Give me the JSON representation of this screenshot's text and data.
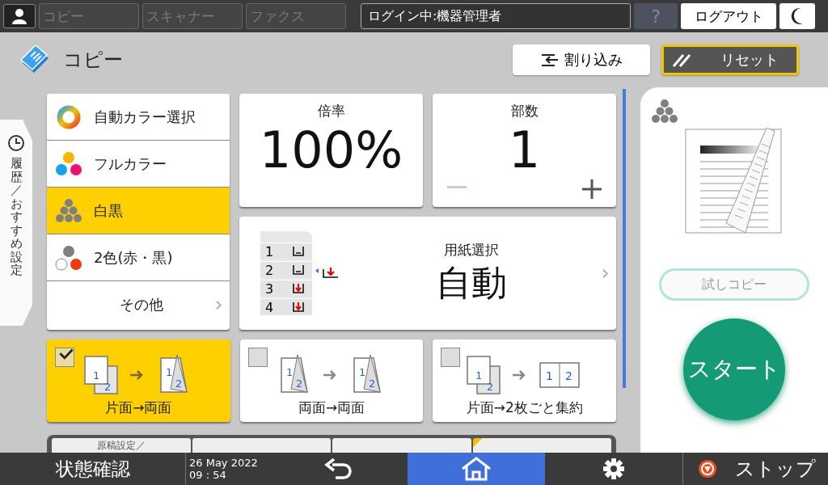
{
  "top_bar": {
    "tabs": [
      {
        "label": "コピー",
        "disabled": true
      },
      {
        "label": "スキャナー",
        "disabled": true
      },
      {
        "label": "ファクス",
        "disabled": true
      }
    ],
    "login": "ログイン中:機器管理者",
    "help": {
      "label": "?",
      "disabled": true
    },
    "logout": "ログアウト"
  },
  "header": {
    "title": "コピー",
    "interrupt": "割り込み",
    "reset": "リセット"
  },
  "side_tab": "履歴／おすすめ設定",
  "color_modes": [
    {
      "label": "自動カラー選択",
      "kind": "auto",
      "selected": false
    },
    {
      "label": "フルカラー",
      "kind": "full",
      "selected": false
    },
    {
      "label": "白黒",
      "kind": "bw",
      "selected": true
    },
    {
      "label": "2色(赤・黒)",
      "kind": "two",
      "selected": false
    }
  ],
  "color_other": "その他",
  "ratio": {
    "label": "倍率",
    "value": "100%"
  },
  "copies": {
    "label": "部数",
    "value": "1"
  },
  "paper": {
    "label": "用紙選択",
    "value": "自動",
    "trays": [
      {
        "label": "1",
        "kind": "loaded"
      },
      {
        "label": "2",
        "kind": "loaded"
      },
      {
        "label": "3",
        "kind": "arrow"
      },
      {
        "label": "4",
        "kind": "arrow"
      }
    ]
  },
  "duplex": [
    {
      "label": "片面→両面",
      "kind": "one-to-two",
      "checked": true,
      "source_pages": [
        "1",
        "2"
      ],
      "result_pages": [
        "1",
        "2"
      ]
    },
    {
      "label": "両面→両面",
      "kind": "two-to-two",
      "checked": false,
      "source_pages": [
        "1",
        "2"
      ],
      "result_pages": [
        "1",
        "2"
      ]
    },
    {
      "label": "片面→2枚ごと集約",
      "kind": "combine",
      "checked": false,
      "source_pages": [
        "1",
        "2"
      ],
      "result_pages": [
        "1",
        "2"
      ]
    }
  ],
  "bottom_tabs": [
    {
      "label": "原稿設定／",
      "flagged": false
    },
    {
      "flagged": false
    },
    {
      "flagged": false
    },
    {
      "flagged": true
    }
  ],
  "right_panel": {
    "trial": {
      "label": "試しコピー",
      "disabled": true
    },
    "start": "スタート"
  },
  "status_bar": {
    "status": "状態確認",
    "date": "26 May 2022",
    "time": "09 : 54",
    "home_selected": true,
    "stop": "ストップ"
  }
}
